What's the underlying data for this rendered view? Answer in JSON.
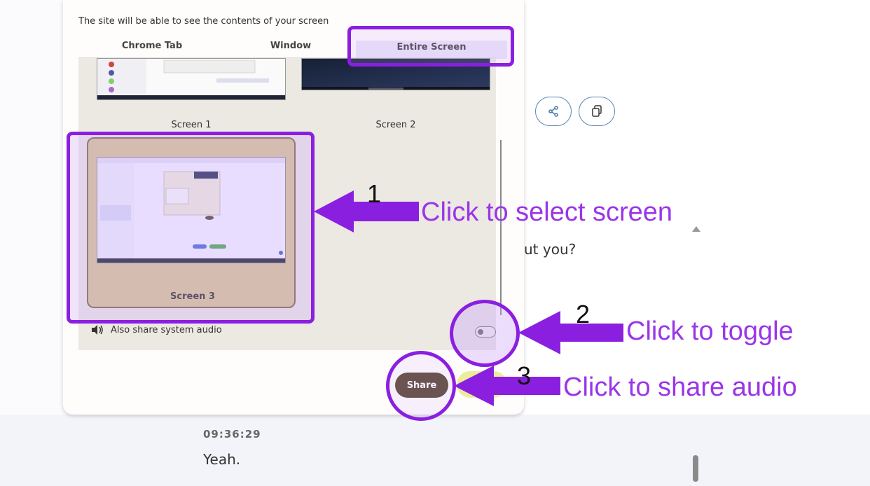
{
  "dialog": {
    "subtitle": "The site will be able to see the contents of your screen",
    "tabs": [
      {
        "label": "Chrome Tab"
      },
      {
        "label": "Window"
      },
      {
        "label": "Entire Screen"
      }
    ],
    "screens": [
      {
        "label": "Screen 1"
      },
      {
        "label": "Screen 2"
      },
      {
        "label": "Screen 3"
      }
    ],
    "audio_label": "Also share system audio",
    "share_label": "Share"
  },
  "background": {
    "partial_text": "ut you?",
    "timestamp": "09:36:29",
    "message": "Yeah."
  },
  "annotations": {
    "step1_number": "1",
    "step1_text": "Click to select screen",
    "step2_number": "2",
    "step2_text": "Click to toggle",
    "step3_number": "3",
    "step3_text": "Click to share audio"
  },
  "colors": {
    "highlight": "#8b1fe0",
    "annotation_text": "#9a35e8",
    "share_button": "#5a4632"
  },
  "icons": [
    "share-icon",
    "copy-icon",
    "speaker-icon",
    "arrow-left-icon"
  ]
}
